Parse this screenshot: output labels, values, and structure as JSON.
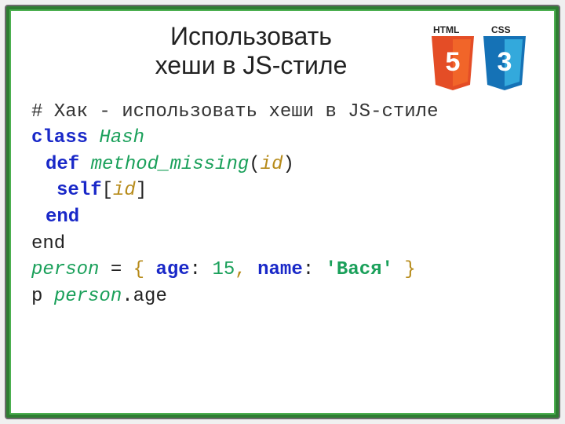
{
  "title": {
    "line1": "Использовать",
    "line2": "хеши в JS-стиле"
  },
  "badges": {
    "html_label": "HTML",
    "css_label": "CSS",
    "html_num": "5",
    "css_num": "3"
  },
  "code": {
    "comment": "# Хак - использовать хеши в JS-стиле",
    "class_kw": "class",
    "class_name": "Hash",
    "def_kw": "def",
    "method_name": "method_missing",
    "param": "id",
    "self_kw": "self",
    "end_kw": "end",
    "end_plain": "end",
    "var_person": "person",
    "equals": " = ",
    "open_brace": "{ ",
    "age_key": "age",
    "colon": ": ",
    "age_val": "15",
    "comma": ", ",
    "name_key": "name",
    "name_val": "'Вася'",
    "close_brace": " }",
    "p_fn": "p ",
    "dot": ".",
    "age_attr": "age"
  }
}
